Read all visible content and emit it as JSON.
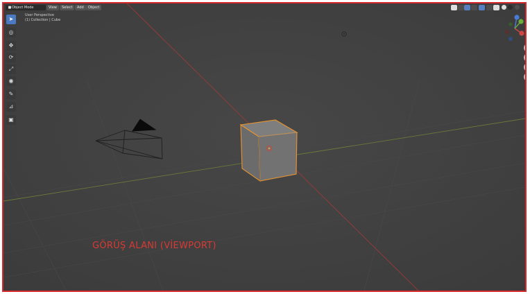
{
  "header": {
    "mode_label": "Object Mode",
    "menus": [
      "View",
      "Select",
      "Add",
      "Object"
    ]
  },
  "overlay": {
    "perspective": "User Perspective",
    "collection": "(1) Collection | Cube"
  },
  "tools": [
    {
      "name": "select-tool",
      "icon": "cursor-arrow-icon",
      "active": true
    },
    {
      "name": "cursor-tool",
      "icon": "3d-cursor-icon",
      "active": false
    },
    {
      "name": "move-tool",
      "icon": "move-icon",
      "active": false
    },
    {
      "name": "rotate-tool",
      "icon": "rotate-icon",
      "active": false
    },
    {
      "name": "scale-tool",
      "icon": "scale-icon",
      "active": false
    },
    {
      "name": "transform-tool",
      "icon": "transform-icon",
      "active": false
    },
    {
      "name": "annotate-tool",
      "icon": "pencil-icon",
      "active": false
    },
    {
      "name": "measure-tool",
      "icon": "ruler-icon",
      "active": false
    },
    {
      "name": "add-cube-tool",
      "icon": "cube-add-icon",
      "active": false
    }
  ],
  "gizmo": {
    "x": "X",
    "y": "Y",
    "z": "Z"
  },
  "caption": "GÖRÜŞ ALANI (VİEWPORT)",
  "colors": {
    "border": "#d4282b",
    "caption": "#d73a34",
    "x_axis": "#9a3a3a",
    "y_axis": "#6a7a3a",
    "selection": "#e8942e",
    "active_tool": "#4d78c2"
  }
}
